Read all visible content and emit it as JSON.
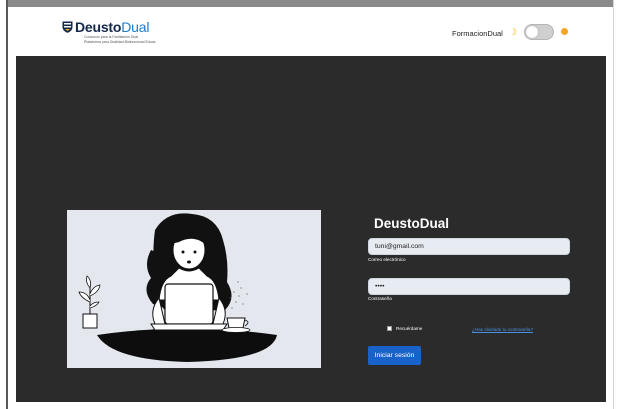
{
  "header": {
    "logo": {
      "brand_bold": "Deusto",
      "brand_light": "Dual",
      "subtitle_line1": "Consorcio para la Facilitación Dual",
      "subtitle_line2": "Plataforma para Dualidad Bidireccional Educa"
    },
    "user_name": "FormacionDual",
    "theme_toggle": {
      "state": "off",
      "left_icon": "moon-icon",
      "right_icon": "sun-icon"
    }
  },
  "login": {
    "title": "DeustoDual",
    "email": {
      "value": "tuni@gmail.com",
      "label": "Correo electrónico"
    },
    "password": {
      "value": "••••",
      "label": "Contraseña"
    },
    "remember_label": "Recuérdame",
    "forgot_link": "¿Has olvidado tu contraseña?",
    "submit_label": "Iniciar sesión"
  },
  "colors": {
    "brand_navy": "#13294b",
    "brand_blue": "#1f7ac9",
    "panel_bg": "#2b2b2b",
    "button_bg": "#1862c9",
    "link": "#4a90e2",
    "sun": "#f5a623"
  }
}
